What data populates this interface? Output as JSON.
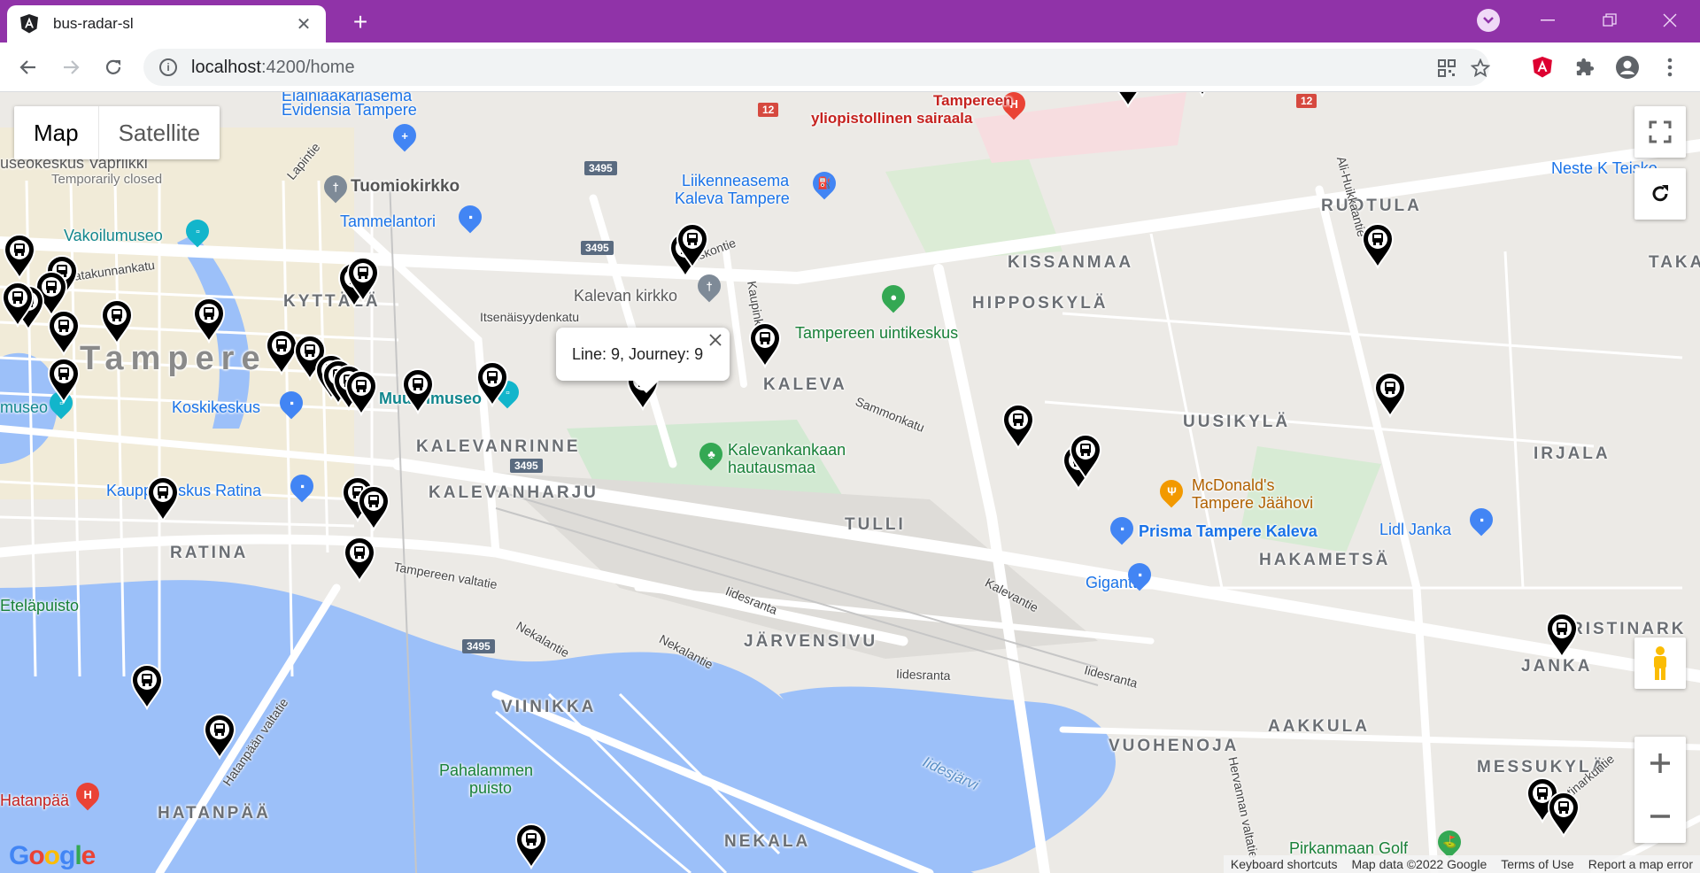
{
  "browser": {
    "tab_title": "bus-radar-sl",
    "url_host": "localhost",
    "url_rest": ":4200/home"
  },
  "map": {
    "type_control": {
      "map": "Map",
      "satellite": "Satellite"
    },
    "info_window": "Line: 9, Journey: 9",
    "attribution": {
      "keyboard": "Keyboard shortcuts",
      "data": "Map data ©2022 Google",
      "terms": "Terms of Use",
      "report": "Report a map error"
    },
    "labels": {
      "city": "Tampere",
      "districts": [
        "KYTTÄLÄ",
        "KALEVANRINNE",
        "KALEVANHARJU",
        "KALEVA",
        "KISSANMAA",
        "HIPPOSKYLÄ",
        "RUOTULA",
        "UUSIKYLÄ",
        "HAKAMETSÄ",
        "IRJALA",
        "TULLI",
        "JÄRVENSIVU",
        "VIINIKKA",
        "NEKALA",
        "VUOHENOJA",
        "AAKKULA",
        "MESSUKYLÄ",
        "HATANPÄÄ",
        "RATINA",
        "JANKA",
        "RISTINARK",
        "TAKA"
      ],
      "pois": {
        "hospital": [
          "Tampereen",
          "yliopistollinen sairaala"
        ],
        "evidensia": [
          "Eläinlääkäriasema",
          "Evidensia Tampere"
        ],
        "vapriikki": [
          "useokeskus Vapriikki",
          "Temporarily closed"
        ],
        "tuomiokirkko": "Tuomiokirkko",
        "tammelantori": "Tammelantori",
        "vakoilumuseo": "Vakoilumuseo",
        "liikenneasema": [
          "Liikenneasema",
          "Kaleva Tampere"
        ],
        "kalevan_kirkko": "Kalevan kirkko",
        "uintikeskus": "Tampereen uintikeskus",
        "muumimuseo": "Muumimuseo",
        "koskikeskus": "Koskikeskus",
        "museo": "museo",
        "kauppakeskus": "Kauppakeskus Ratina",
        "hautausmaa": [
          "Kalevankankaan",
          "hautausmaa"
        ],
        "mcdonalds": [
          "McDonald's",
          "Tampere Jäähovi"
        ],
        "prisma": "Prisma Tampere Kaleva",
        "lidl": "Lidl Janka",
        "gigantti": "Gigantti",
        "neste": "Neste K Teisko",
        "etelapuisto": "Eteläpuisto",
        "hatanpaa": "Hatanpää",
        "pahalammen": [
          "Pahalammen",
          "puisto"
        ],
        "pirkanmaan": "Pirkanmaan Golf",
        "iidesjarvi": "Iidesjärvi"
      },
      "roads": [
        "Satakunnankatu",
        "Lapintie",
        "Itsenäisyydenkatu",
        "Teiskontie",
        "Kaupinkatu",
        "Sammonkatu",
        "Ali-Huikkaantie",
        "Tampereen valtatie",
        "Nekalantie",
        "Iidesranta",
        "Kalevantie",
        "Hatanpään valtatie",
        "Ristinarkuntie",
        "Hervannan valtatie"
      ],
      "shields": [
        "12",
        "12",
        "3495",
        "3495",
        "3495",
        "3495"
      ]
    },
    "colors": {
      "marker": "#000000",
      "titlebar": "#9033a8"
    }
  }
}
